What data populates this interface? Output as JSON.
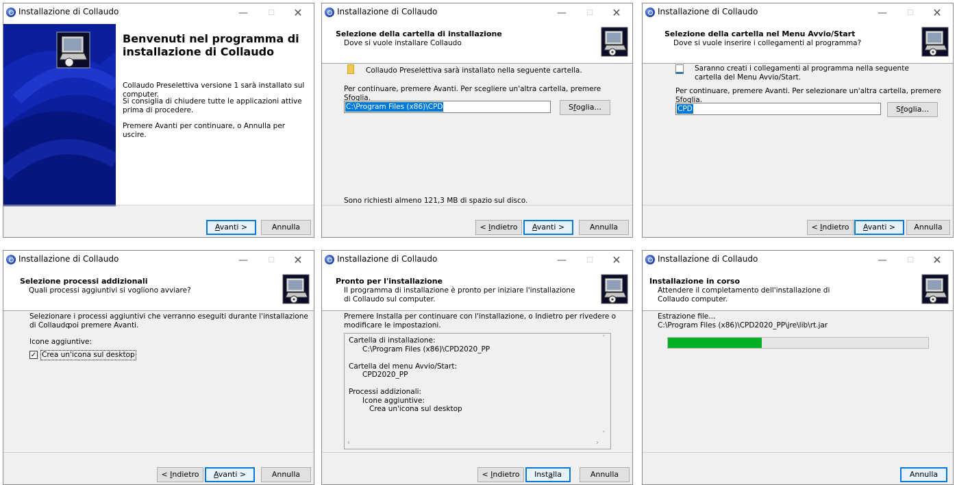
{
  "window_title": "Installazione di Collaudo",
  "buttons": {
    "back": "< Indietro",
    "back_key": "I",
    "back_rest": "ndietro",
    "next_key": "A",
    "next_rest": "vanti >",
    "cancel": "Annulla",
    "install_pre": "Inst",
    "install_key": "a",
    "install_rest": "lla",
    "browse_pre": "S",
    "browse_key": "f",
    "browse_rest": "oglia..."
  },
  "welcome": {
    "title": "Benvenuti nel programma di installazione di Collaudo",
    "p1": "Collaudo Preselettiva versione 1 sarà installato sul computer.",
    "p2": "Si consiglia di chiudere tutte le applicazioni attive prima di procedere.",
    "p3": "Premere Avanti per continuare, o Annulla per uscire."
  },
  "dest_dir": {
    "title": "Selezione della cartella di installazione",
    "subtitle": "Dove si vuole installare Collaudo",
    "info": "Collaudo Preselettiva sarà installato nella seguente cartella.",
    "instruction": "Per continuare, premere Avanti. Per scegliere un'altra cartella, premere Sfoglia.",
    "path": "C:\\Program Files (x86)\\CPD",
    "space": "Sono richiesti almeno 121,3 MB di spazio sul disco."
  },
  "start_menu": {
    "title": "Selezione della cartella nel Menu Avvio/Start",
    "subtitle": "Dove si vuole inserire i collegamenti al programma?",
    "info": "Saranno creati i collegamenti al programma nella seguente cartella del Menu Avvio/Start.",
    "instruction": "Per continuare, premere Avanti. Per selezionare un'altra cartella, premere Sfoglia.",
    "folder": "CPD"
  },
  "tasks": {
    "title": "Selezione processi addizionali",
    "subtitle": "Quali processi aggiuntivi si vogliono avviare?",
    "info_line1": "Selezionare i processi aggiuntivi che verranno eseguiti durante l'installazione di Collaudo",
    "info_line2": "poi premere Avanti.",
    "group": "Icone aggiuntive:",
    "checkbox_label": "Crea un'icona sul desktop",
    "checkbox_checked": true
  },
  "ready": {
    "title": "Pronto per l'installazione",
    "subtitle": "Il programma di installazione è pronto per iniziare l'installazione di Collaudo sul computer.",
    "instruction": "Premere Installa per continuare con l'installazione, o Indietro per rivedere o modificare le impostazioni.",
    "memo": [
      "Cartella di installazione:",
      "      C:\\Program Files (x86)\\CPD2020_PP",
      "",
      "Cartella del menu Avvio/Start:",
      "      CPD2020_PP",
      "",
      "Processi addizionali:",
      "      Icone aggiuntive:",
      "         Crea un'icona sul desktop"
    ]
  },
  "installing": {
    "title": "Installazione in corso",
    "subtitle": "Attendere il completamento dell'installazione di Collaudo computer.",
    "status": "Estrazione file...",
    "file": "C:\\Program Files (x86)\\CPD2020_PP\\jre\\lib\\rt.jar",
    "progress_fraction": 0.36,
    "progress_color": "#06b025"
  }
}
